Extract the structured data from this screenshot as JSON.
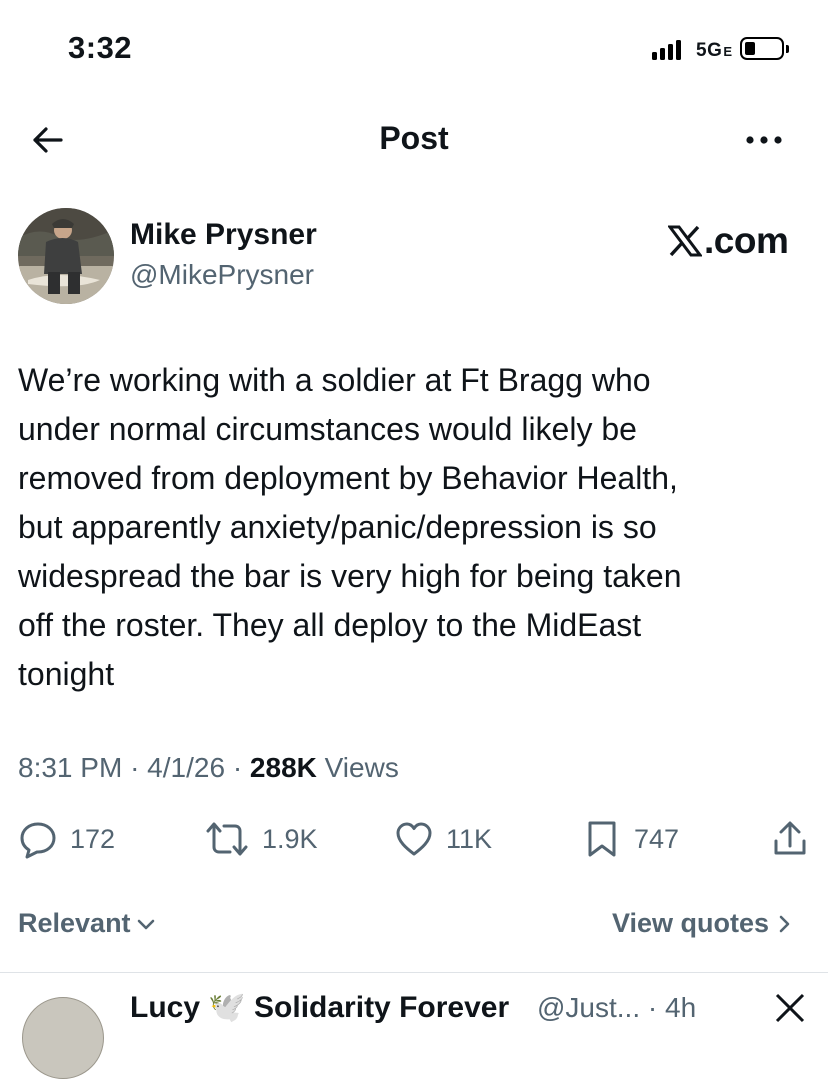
{
  "status_bar": {
    "time": "3:32",
    "network": "5G",
    "network_sub": "E"
  },
  "header": {
    "title": "Post",
    "back_icon": "arrow-left-icon",
    "more_icon": "more-horizontal-icon"
  },
  "post": {
    "author_name": "Mike Prysner",
    "author_handle": "@MikePrysner",
    "source_label": ".com",
    "text": "We’re working with a soldier at Ft Bragg who\nunder normal circumstances would likely be\nremoved from deployment by Behavior Health,\nbut apparently anxiety/panic/depression is so\nwidespread the bar is very high for being taken\noff the roster. They all deploy to the MidEast\ntonight",
    "time": "8:31 PM",
    "date": "4/1/26",
    "separator": "·",
    "views_count": "288K",
    "views_label": "Views"
  },
  "actions": {
    "replies": "172",
    "reposts": "1.9K",
    "likes": "11K",
    "bookmarks": "747"
  },
  "replies_bar": {
    "sort_label": "Relevant",
    "view_quotes_label": "View quotes"
  },
  "next_reply": {
    "name": "Lucy 🕊️ Solidarity Forever",
    "handle_and_time": "@Just... · 4h"
  },
  "colors": {
    "text_primary": "#0f1419",
    "text_secondary": "#536471",
    "divider": "#dfe3e7",
    "background": "#ffffff"
  }
}
